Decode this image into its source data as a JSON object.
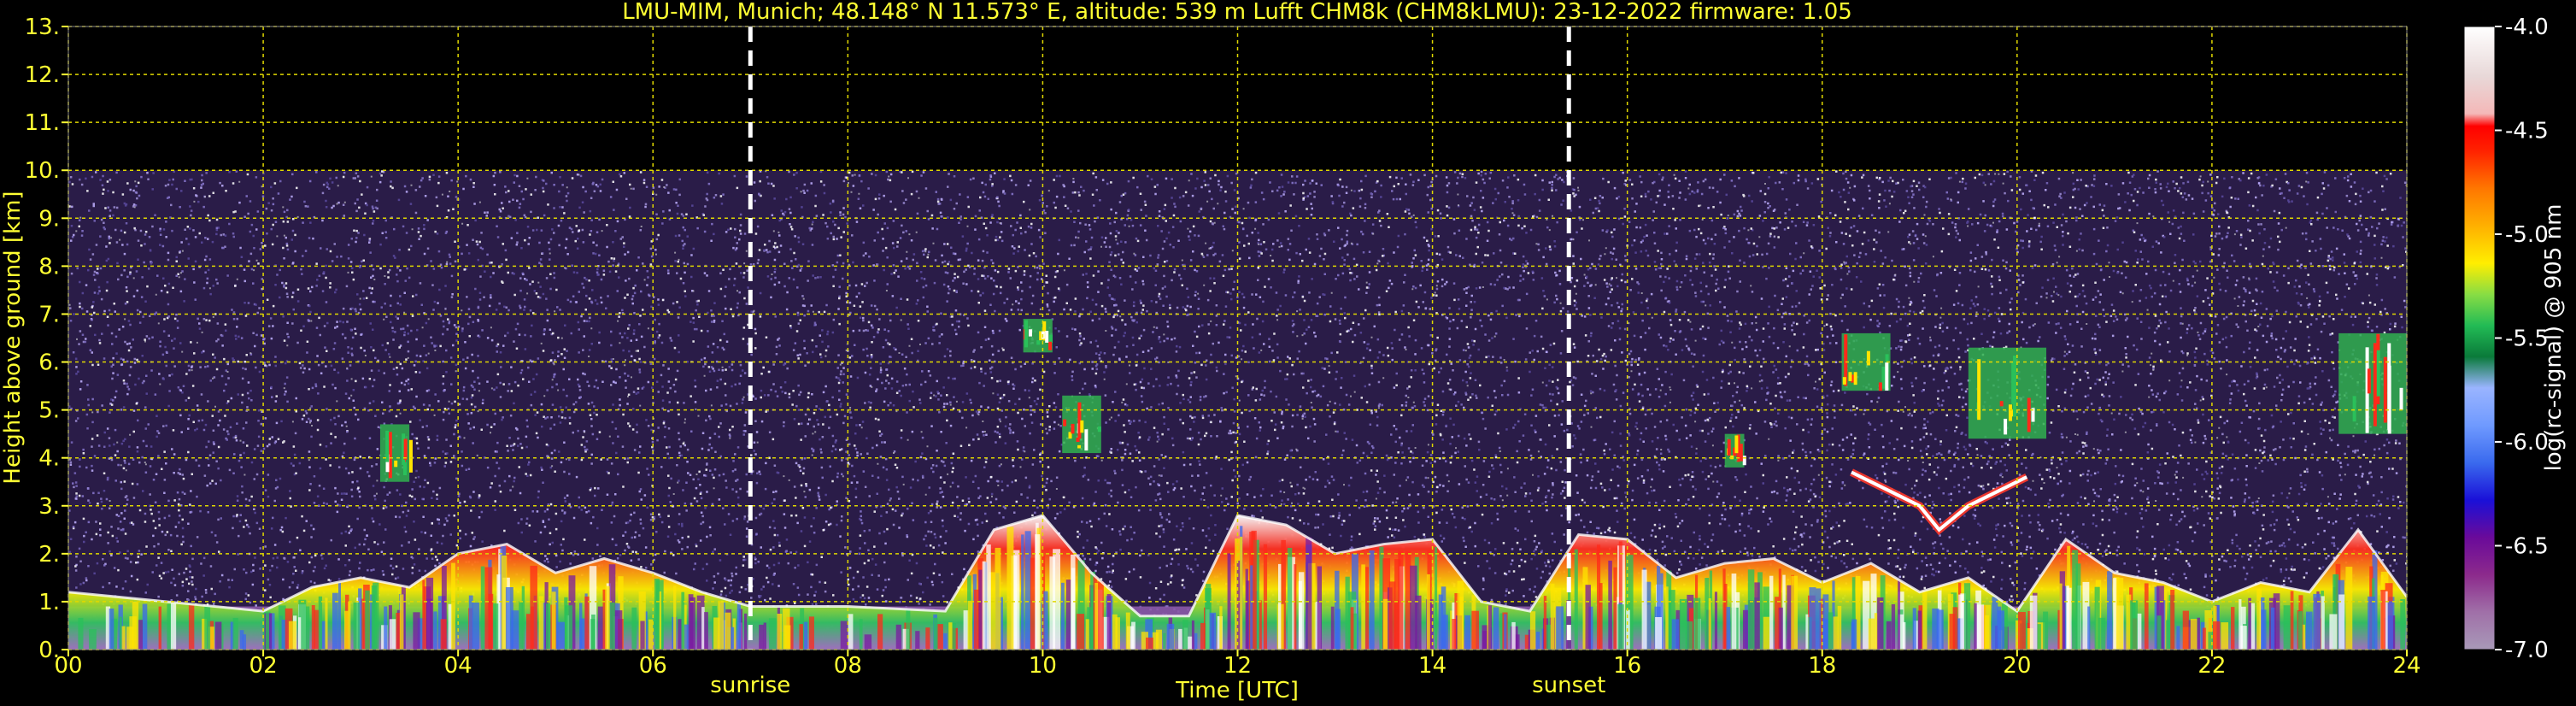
{
  "chart_data": {
    "type": "heatmap",
    "title": "LMU-MIM, Munich; 48.148° N 11.573° E, altitude: 539 m    Lufft CHM8k (CHM8kLMU): 23-12-2022    firmware: 1.05",
    "xlabel": "Time [UTC]",
    "ylabel": "Height above ground [km]",
    "xlim": [
      0,
      24
    ],
    "ylim": [
      0,
      13
    ],
    "x_ticks": [
      "00",
      "02",
      "04",
      "06",
      "08",
      "10",
      "12",
      "14",
      "16",
      "18",
      "20",
      "22",
      "24"
    ],
    "y_ticks": [
      "0.",
      "1.",
      "2.",
      "3.",
      "4.",
      "5.",
      "6.",
      "7.",
      "8.",
      "9.",
      "10.",
      "11.",
      "12.",
      "13."
    ],
    "grid": true,
    "signal_top_km": 10,
    "markers": [
      {
        "label": "sunrise",
        "time": 7.0
      },
      {
        "label": "sunset",
        "time": 15.4
      }
    ],
    "colorbar": {
      "label": "log(rc-signal) @ 905 nm",
      "ticks": [
        "-4.0",
        "-4.5",
        "-5.0",
        "-5.5",
        "-6.0",
        "-6.5",
        "-7.0"
      ],
      "range": [
        -7.0,
        -4.0
      ]
    },
    "boundary_layer_top_km": [
      [
        0,
        1.2
      ],
      [
        1,
        1.0
      ],
      [
        2,
        0.8
      ],
      [
        2.5,
        1.3
      ],
      [
        3,
        1.5
      ],
      [
        3.5,
        1.3
      ],
      [
        4,
        2.0
      ],
      [
        4.5,
        2.2
      ],
      [
        5,
        1.6
      ],
      [
        5.5,
        1.9
      ],
      [
        6,
        1.6
      ],
      [
        6.5,
        1.2
      ],
      [
        7,
        0.9
      ],
      [
        8,
        0.9
      ],
      [
        9,
        0.8
      ],
      [
        9.5,
        2.5
      ],
      [
        10,
        2.8
      ],
      [
        10.5,
        1.6
      ],
      [
        11,
        0.7
      ],
      [
        11.5,
        0.7
      ],
      [
        12,
        2.8
      ],
      [
        12.5,
        2.6
      ],
      [
        13,
        2.0
      ],
      [
        13.5,
        2.2
      ],
      [
        14,
        2.3
      ],
      [
        14.5,
        1.0
      ],
      [
        15,
        0.8
      ],
      [
        15.5,
        2.4
      ],
      [
        16,
        2.3
      ],
      [
        16.5,
        1.5
      ],
      [
        17,
        1.8
      ],
      [
        17.5,
        1.9
      ],
      [
        18,
        1.4
      ],
      [
        18.5,
        1.8
      ],
      [
        19,
        1.2
      ],
      [
        19.5,
        1.5
      ],
      [
        20,
        0.8
      ],
      [
        20.5,
        2.3
      ],
      [
        21,
        1.6
      ],
      [
        21.5,
        1.4
      ],
      [
        22,
        1.0
      ],
      [
        22.5,
        1.4
      ],
      [
        23,
        1.2
      ],
      [
        23.5,
        2.5
      ],
      [
        24,
        1.1
      ]
    ],
    "cloud_layers_km": [
      {
        "t0": 3.2,
        "t1": 3.5,
        "h0": 3.5,
        "h1": 4.7
      },
      {
        "t0": 9.8,
        "t1": 10.1,
        "h0": 6.2,
        "h1": 6.9
      },
      {
        "t0": 10.2,
        "t1": 10.6,
        "h0": 4.1,
        "h1": 5.3
      },
      {
        "t0": 17.0,
        "t1": 17.2,
        "h0": 3.8,
        "h1": 4.5
      },
      {
        "t0": 18.2,
        "t1": 18.7,
        "h0": 5.4,
        "h1": 6.6
      },
      {
        "t0": 19.5,
        "t1": 20.3,
        "h0": 4.4,
        "h1": 6.3
      },
      {
        "t0": 23.3,
        "t1": 24.0,
        "h0": 4.5,
        "h1": 6.6
      }
    ],
    "elevated_aerosol_arc_km": [
      [
        18.3,
        3.7
      ],
      [
        18.6,
        3.4
      ],
      [
        19.0,
        3.0
      ],
      [
        19.2,
        2.5
      ],
      [
        19.5,
        3.0
      ],
      [
        19.8,
        3.3
      ],
      [
        20.1,
        3.6
      ]
    ]
  }
}
